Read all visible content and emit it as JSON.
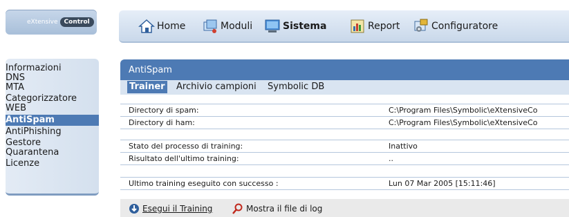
{
  "logo": {
    "part1": "eXtensive",
    "part2": "Control"
  },
  "nav": {
    "items": [
      {
        "label": "Home",
        "icon": "home-icon"
      },
      {
        "label": "Moduli",
        "icon": "modules-icon"
      },
      {
        "label": "Sistema",
        "icon": "monitor-icon",
        "active": true
      },
      {
        "label": "Report",
        "icon": "chart-icon"
      },
      {
        "label": "Configuratore",
        "icon": "config-icon"
      }
    ]
  },
  "sidebar": {
    "items": [
      "Informazioni",
      "DNS",
      "MTA",
      "Categorizzatore",
      "WEB",
      "AntiSpam",
      "AntiPhishing",
      "Gestore",
      "Quarantena",
      "Licenze"
    ],
    "active": "AntiSpam"
  },
  "panel": {
    "title": "AntiSpam",
    "tabs": [
      "Trainer",
      "Archivio campioni",
      "Symbolic DB"
    ],
    "active_tab": "Trainer"
  },
  "rows": [
    {
      "key": "Directory di spam:",
      "value": "C:\\Program Files\\Symbolic\\eXtensiveCo"
    },
    {
      "key": "Directory di ham:",
      "value": "C:\\Program Files\\Symbolic\\eXtensiveCo"
    },
    {
      "key": "Stato del processo di training:",
      "value": "Inattivo"
    },
    {
      "key": "Risultato dell'ultimo training:",
      "value": ".."
    },
    {
      "key": "Ultimo training eseguito con successo :",
      "value": "Lun 07 Mar 2005 [15:11:46]"
    }
  ],
  "footer": {
    "run_label": "Esegui il Training",
    "log_label": "Mostra il file di log"
  },
  "colors": {
    "accent": "#4d7ab4",
    "tab_bg": "#d9e4f1",
    "separator": "#b4c6dc"
  }
}
